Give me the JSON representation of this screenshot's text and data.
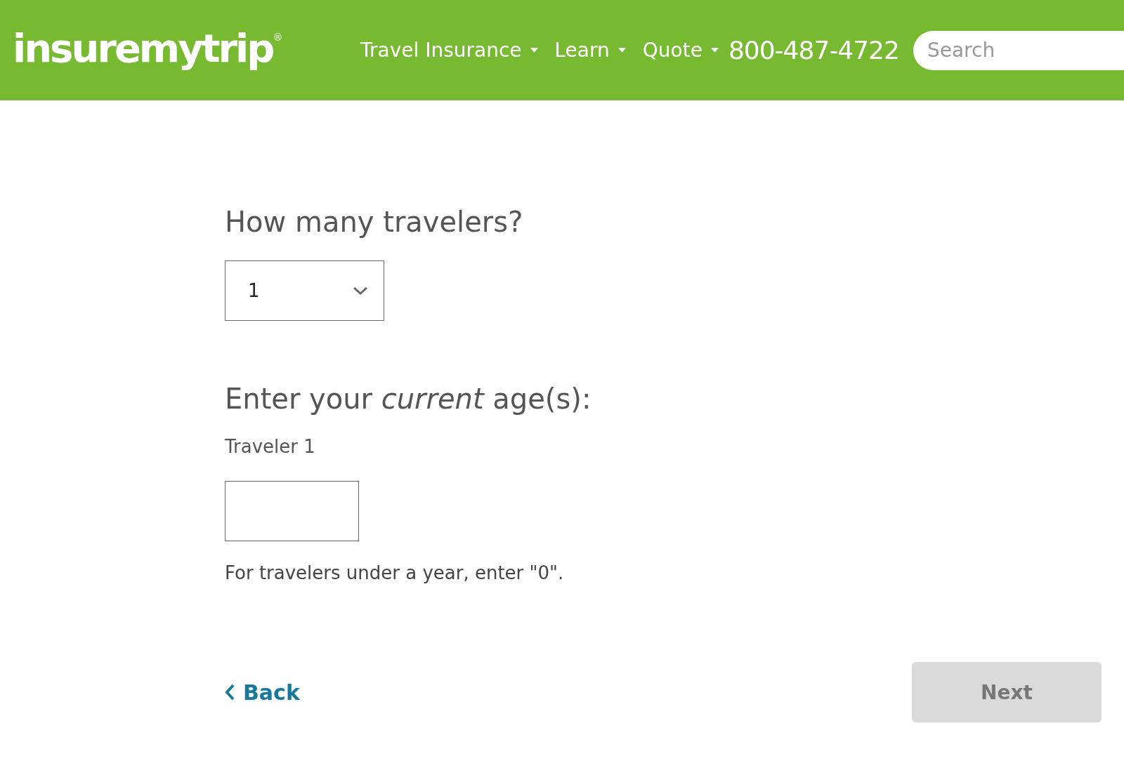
{
  "header": {
    "logo": "insuremytrip",
    "logo_mark": "®",
    "nav": [
      {
        "label": "Travel Insurance"
      },
      {
        "label": "Learn"
      },
      {
        "label": "Quote"
      }
    ],
    "phone": "800-487-4722",
    "search": {
      "placeholder": "Search"
    }
  },
  "travelers": {
    "question": "How many travelers?",
    "value": "1"
  },
  "ages": {
    "question": "Enter your *current* age(s):",
    "fields": [
      {
        "label": "Traveler 1"
      }
    ],
    "hint": "For travelers under a year, enter \"0\"."
  },
  "footer": {
    "back": "Back",
    "next": {
      "label": "Next",
      "disabled": true
    }
  }
}
